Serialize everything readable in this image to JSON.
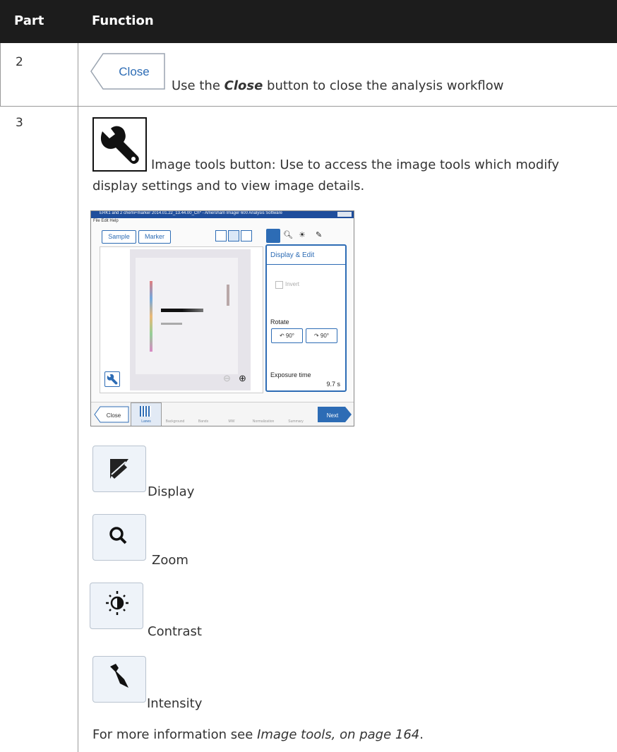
{
  "header": {
    "part": "Part",
    "function": "Function"
  },
  "rows": [
    {
      "part": "2",
      "close_label": "Close",
      "desc_prefix": "Use the ",
      "desc_bold": "Close",
      "desc_suffix": " button to close the analysis workflow"
    },
    {
      "part": "3",
      "desc_line1": "Image tools button: Use to access the image tools which modify",
      "desc_line2": "display settings and to view image details.",
      "screenshot": {
        "title": "ERK1 and 2 chemi+marker 2014.01.22_13.44.00_Ch* - Amersham Imager 600 Analysis Software",
        "menu": [
          "File",
          "Edit",
          "Help"
        ],
        "sample_btn": "Sample",
        "marker_btn": "Marker",
        "panel_title": "Display & Edit",
        "invert_label": "Invert",
        "rotate_label": "Rotate",
        "rotate_left": "90°",
        "rotate_right": "90°",
        "exposure_label": "Exposure time",
        "exposure_value": "9.7 s",
        "close_btn": "Close",
        "next_btn": "Next",
        "steps": [
          "Lanes",
          "Background",
          "Bands",
          "MW",
          "Normalization",
          "Summary"
        ]
      },
      "tools": [
        {
          "label": "Display",
          "icon": "display-icon"
        },
        {
          "label": "Zoom",
          "icon": "zoom-icon"
        },
        {
          "label": "Contrast",
          "icon": "contrast-icon"
        },
        {
          "label": "Intensity",
          "icon": "intensity-icon"
        }
      ],
      "more_prefix": "For more information see ",
      "more_link": "Image tools, on page 164",
      "more_suffix": "."
    }
  ],
  "colors": {
    "header_bg": "#1c1c1c",
    "accent_blue": "#2d6cb5",
    "tool_bg": "#eef3f9"
  }
}
